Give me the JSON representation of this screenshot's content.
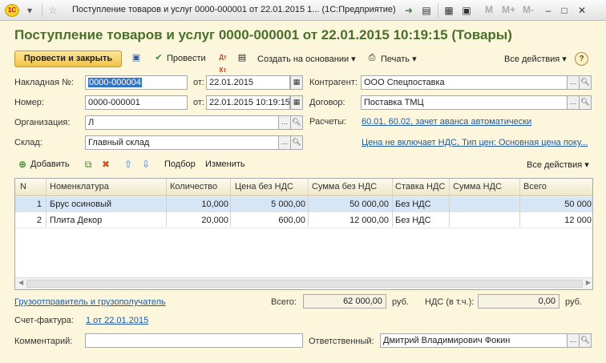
{
  "window": {
    "logo": "1С",
    "title": "Поступление товаров и услуг 0000-000001 от 22.01.2015 1...   (1С:Предприятие)",
    "m_buttons": [
      "M",
      "M+",
      "M-"
    ]
  },
  "document": {
    "title": "Поступление товаров и услуг 0000-000001 от 22.01.2015 10:19:15 (Товары)"
  },
  "commands": {
    "post_close": "Провести и закрыть",
    "post": "Провести",
    "create_based": "Создать на основании ▾",
    "print": "Печать ▾",
    "all_actions": "Все действия ▾",
    "help": "?"
  },
  "form": {
    "invoice_label": "Накладная №:",
    "invoice_value": "0000-000004",
    "invoice_date_label": "от:",
    "invoice_date_value": "22.01.2015",
    "number_label": "Номер:",
    "number_value": "0000-000001",
    "date_label": "от:",
    "date_value": "22.01.2015 10:19:15",
    "org_label": "Организация:",
    "org_value": "Л",
    "warehouse_label": "Склад:",
    "warehouse_value": "Главный склад",
    "counterparty_label": "Контрагент:",
    "counterparty_value": "ООО Спецпоставка",
    "contract_label": "Договор:",
    "contract_value": "Поставка ТМЦ",
    "settlements_label": "Расчеты:",
    "settlements_link": "60.01, 60.02, зачет аванса автоматически",
    "price_link": "Цена не включает НДС, Тип цен: Основная цена поку..."
  },
  "table_toolbar": {
    "add": "Добавить",
    "pick": "Подбор",
    "change": "Изменить",
    "all_actions": "Все действия ▾"
  },
  "table": {
    "columns": [
      "N",
      "Номенклатура",
      "Количество",
      "Цена без НДС",
      "Сумма без НДС",
      "Ставка НДС",
      "Сумма НДС",
      "Всего"
    ],
    "rows": [
      {
        "n": "1",
        "item": "Брус осиновый",
        "qty": "10,000",
        "price": "5 000,00",
        "sum": "50 000,00",
        "rate": "Без НДС",
        "vat": "",
        "total": "50 000,"
      },
      {
        "n": "2",
        "item": "Плита Декор",
        "qty": "20,000",
        "price": "600,00",
        "sum": "12 000,00",
        "rate": "Без НДС",
        "vat": "",
        "total": "12 000,"
      }
    ]
  },
  "bottom": {
    "consignee_link": "Грузоотправитель и грузополучатель",
    "total_label": "Всего:",
    "total_value": "62 000,00",
    "total_currency": "руб.",
    "vat_label": "НДС (в т.ч.):",
    "vat_value": "0,00",
    "vat_currency": "руб.",
    "invoice_label": "Счет-фактура:",
    "invoice_link": "1 от 22.01.2015",
    "comment_label": "Комментарий:",
    "comment_value": "",
    "responsible_label": "Ответственный:",
    "responsible_value": "Дмитрий Владимирович Фокин"
  }
}
